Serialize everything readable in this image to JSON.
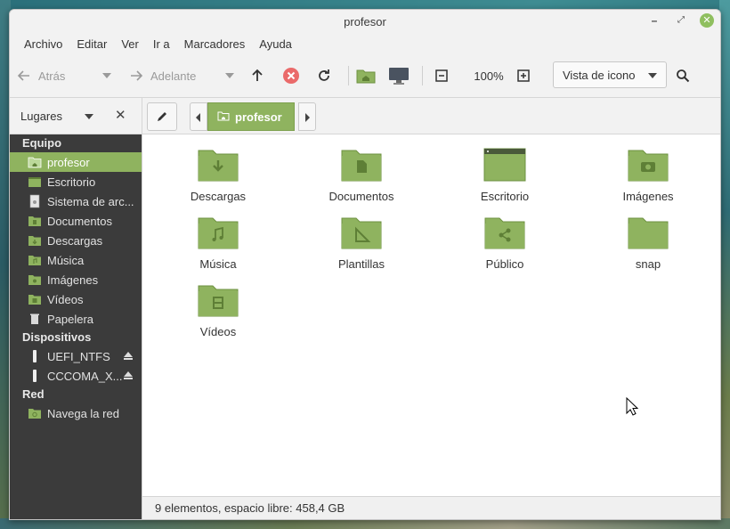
{
  "window": {
    "title": "profesor"
  },
  "menu": [
    "Archivo",
    "Editar",
    "Ver",
    "Ir a",
    "Marcadores",
    "Ayuda"
  ],
  "toolbar": {
    "back_label": "Atrás",
    "forward_label": "Adelante",
    "zoom": "100%",
    "view_mode": "Vista de icono"
  },
  "places": {
    "label": "Lugares"
  },
  "location": {
    "current": "profesor"
  },
  "sidebar": {
    "sections": [
      {
        "title": "Equipo",
        "items": [
          {
            "label": "profesor",
            "icon": "home-folder-icon",
            "active": true
          },
          {
            "label": "Escritorio",
            "icon": "desktop-folder-icon"
          },
          {
            "label": "Sistema de arc...",
            "icon": "filesystem-icon"
          },
          {
            "label": "Documentos",
            "icon": "documents-folder-icon"
          },
          {
            "label": "Descargas",
            "icon": "downloads-folder-icon"
          },
          {
            "label": "Música",
            "icon": "music-folder-icon"
          },
          {
            "label": "Imágenes",
            "icon": "pictures-folder-icon"
          },
          {
            "label": "Vídeos",
            "icon": "videos-folder-icon"
          },
          {
            "label": "Papelera",
            "icon": "trash-icon"
          }
        ]
      },
      {
        "title": "Dispositivos",
        "items": [
          {
            "label": "UEFI_NTFS",
            "icon": "usb-drive-icon",
            "eject": true
          },
          {
            "label": "CCCOMA_X...",
            "icon": "usb-drive-icon",
            "eject": true
          }
        ]
      },
      {
        "title": "Red",
        "items": [
          {
            "label": "Navega la red",
            "icon": "network-folder-icon"
          }
        ]
      }
    ]
  },
  "files": [
    {
      "name": "Descargas",
      "icon": "download-arrow-icon"
    },
    {
      "name": "Documentos",
      "icon": "document-icon"
    },
    {
      "name": "Escritorio",
      "icon": "desktop-icon"
    },
    {
      "name": "Imágenes",
      "icon": "camera-icon"
    },
    {
      "name": "Música",
      "icon": "music-note-icon"
    },
    {
      "name": "Plantillas",
      "icon": "template-icon"
    },
    {
      "name": "Público",
      "icon": "share-icon"
    },
    {
      "name": "snap",
      "icon": "folder-icon"
    },
    {
      "name": "Vídeos",
      "icon": "film-icon"
    }
  ],
  "status": {
    "text": "9 elementos, espacio libre: 458,4 GB"
  },
  "colors": {
    "accent": "#8fb35f",
    "sidebar_bg": "#3b3b3b",
    "folder_green": "#8fb35f"
  }
}
